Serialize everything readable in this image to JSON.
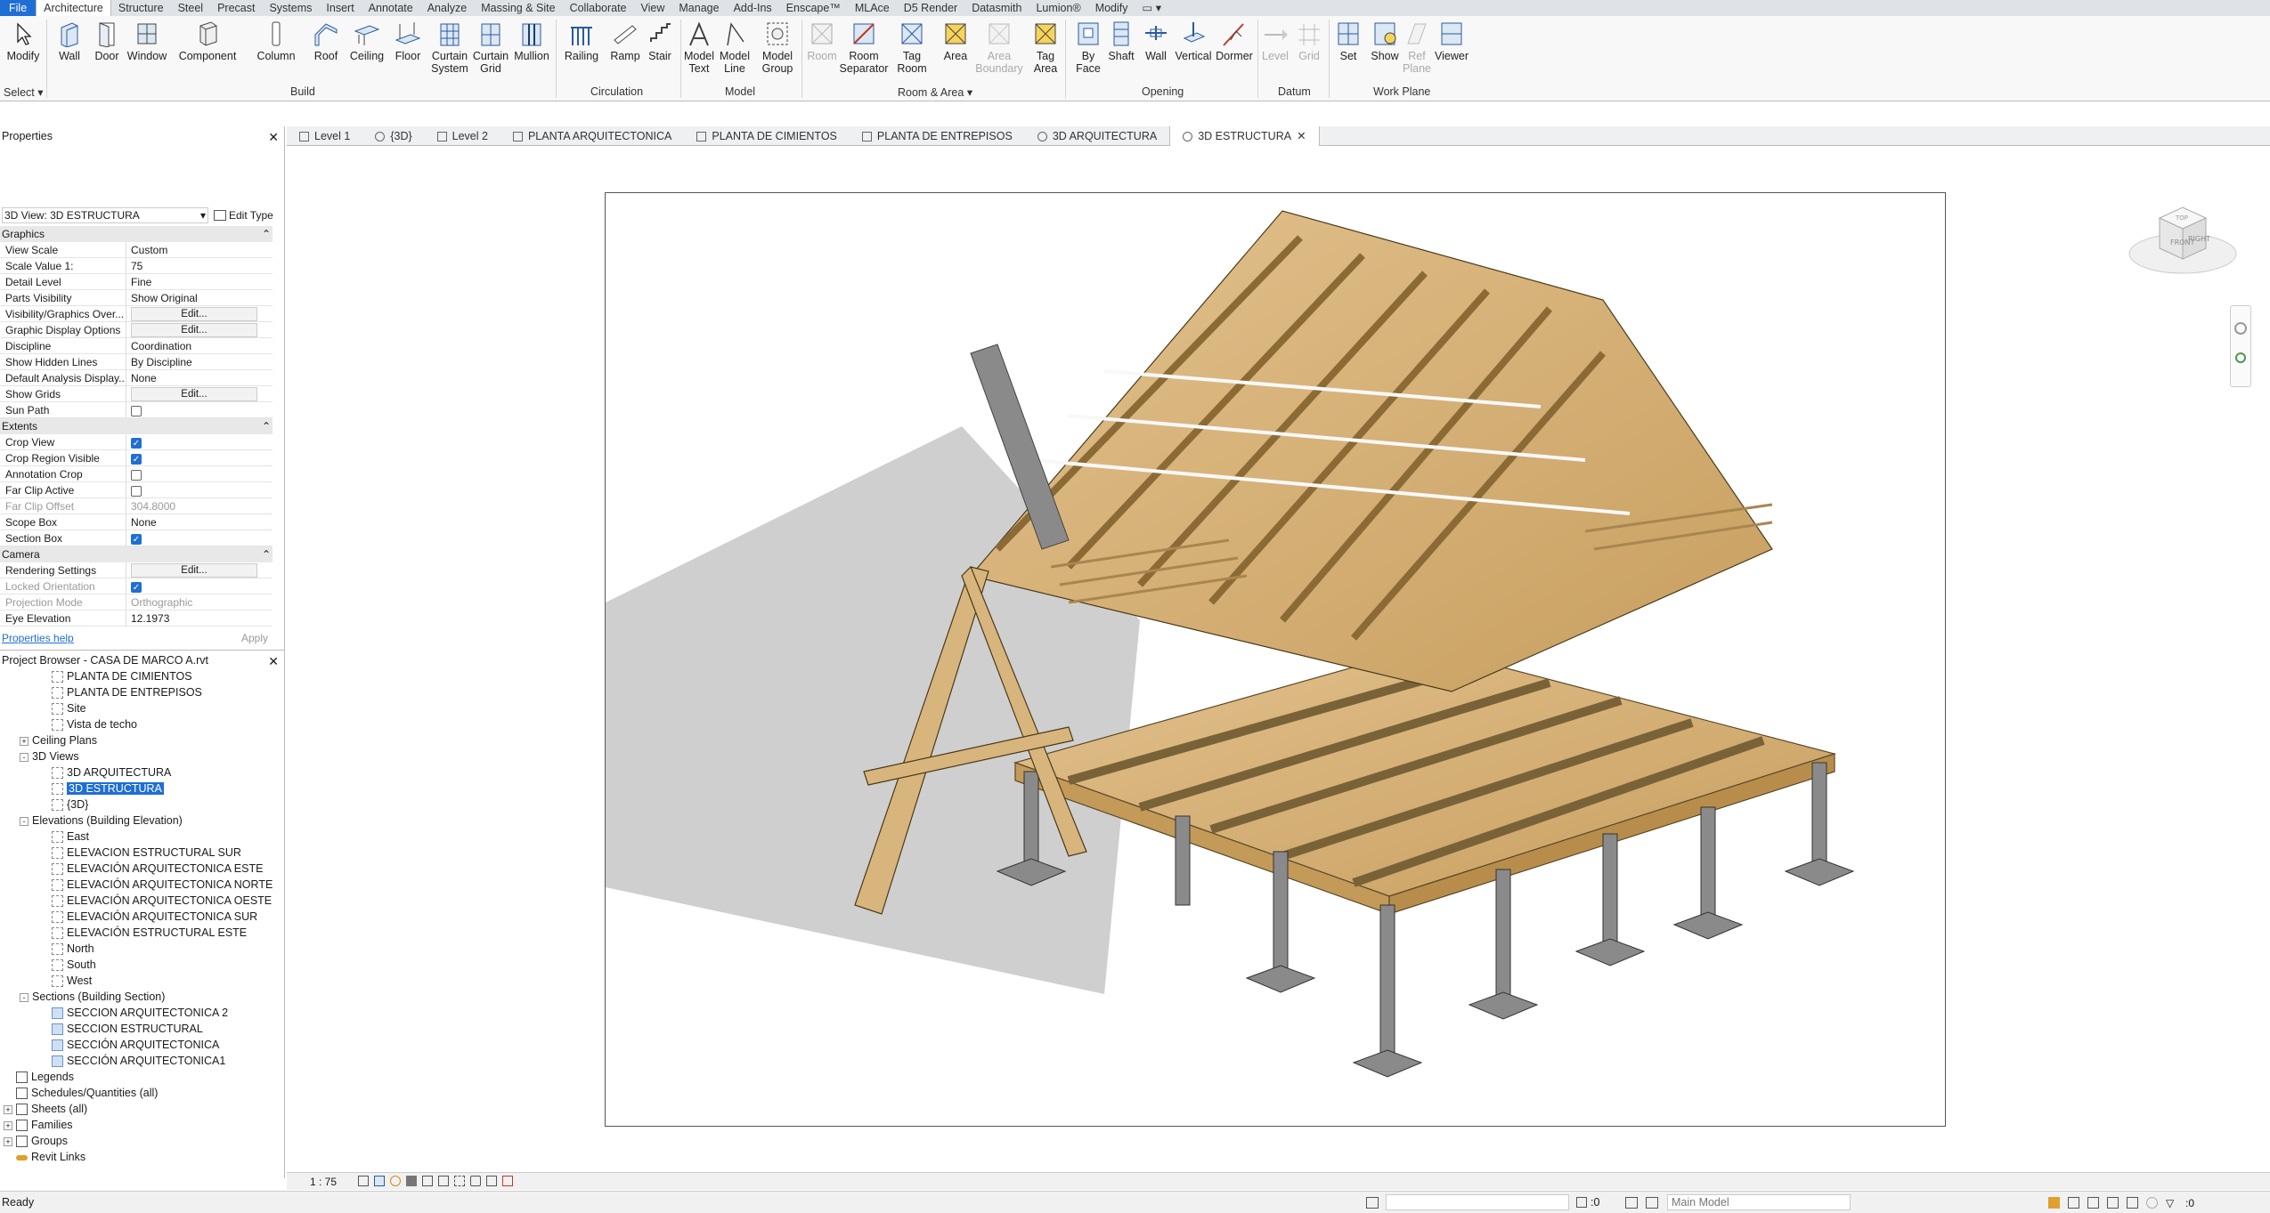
{
  "menu": {
    "tabs": [
      "File",
      "Architecture",
      "Structure",
      "Steel",
      "Precast",
      "Systems",
      "Insert",
      "Annotate",
      "Analyze",
      "Massing & Site",
      "Collaborate",
      "View",
      "Manage",
      "Add-Ins",
      "Enscape™",
      "MLAce",
      "D5 Render",
      "Datasmith",
      "Lumion®",
      "Modify"
    ],
    "active": "Architecture"
  },
  "ribbon": {
    "select": {
      "modify": "Modify",
      "select": "Select"
    },
    "build": {
      "label": "Build",
      "wall": "Wall",
      "door": "Door",
      "window": "Window",
      "component": "Component",
      "column": "Column",
      "roof": "Roof",
      "ceiling": "Ceiling",
      "floor": "Floor",
      "curtain_system": "Curtain\nSystem",
      "curtain_grid": "Curtain\nGrid",
      "mullion": "Mullion"
    },
    "circulation": {
      "label": "Circulation",
      "railing": "Railing",
      "ramp": "Ramp",
      "stair": "Stair"
    },
    "model": {
      "label": "Model",
      "model_text": "Model\nText",
      "model_line": "Model\nLine",
      "model_group": "Model\nGroup"
    },
    "room": {
      "label": "Room & Area",
      "room": "Room",
      "room_separator": "Room\nSeparator",
      "tag_room": "Tag\nRoom",
      "area": "Area",
      "area_boundary": "Area\nBoundary",
      "tag_area": "Tag\nArea"
    },
    "opening": {
      "label": "Opening",
      "by_face": "By\nFace",
      "shaft": "Shaft",
      "wall": "Wall",
      "vertical": "Vertical",
      "dormer": "Dormer"
    },
    "datum": {
      "label": "Datum",
      "level": "Level",
      "grid": "Grid"
    },
    "workplane": {
      "label": "Work Plane",
      "set": "Set",
      "show": "Show",
      "ref_plane": "Ref\nPlane",
      "viewer": "Viewer"
    }
  },
  "properties": {
    "title": "Properties",
    "type_selector": "3D View: 3D ESTRUCTURA",
    "edit_type": "Edit Type",
    "graphics_header": "Graphics",
    "graphics": [
      {
        "k": "View Scale",
        "v": "Custom"
      },
      {
        "k": "Scale Value    1:",
        "v": "75"
      },
      {
        "k": "Detail Level",
        "v": "Fine"
      },
      {
        "k": "Parts Visibility",
        "v": "Show Original"
      },
      {
        "k": "Visibility/Graphics Over...",
        "v": "Edit...",
        "btn": true
      },
      {
        "k": "Graphic Display Options",
        "v": "Edit...",
        "btn": true
      },
      {
        "k": "Discipline",
        "v": "Coordination"
      },
      {
        "k": "Show Hidden Lines",
        "v": "By Discipline"
      },
      {
        "k": "Default Analysis Display...",
        "v": "None"
      },
      {
        "k": "Show Grids",
        "v": "Edit...",
        "btn": true
      },
      {
        "k": "Sun Path",
        "v": "",
        "cb": false
      }
    ],
    "extents_header": "Extents",
    "extents": [
      {
        "k": "Crop View",
        "v": "",
        "cb": true
      },
      {
        "k": "Crop Region Visible",
        "v": "",
        "cb": true
      },
      {
        "k": "Annotation Crop",
        "v": "",
        "cb": false
      },
      {
        "k": "Far Clip Active",
        "v": "",
        "cb": false
      },
      {
        "k": "Far Clip Offset",
        "v": "304.8000",
        "dis": true
      },
      {
        "k": "Scope Box",
        "v": "None"
      },
      {
        "k": "Section Box",
        "v": "",
        "cb": true
      }
    ],
    "camera_header": "Camera",
    "camera": [
      {
        "k": "Rendering Settings",
        "v": "Edit...",
        "btn": true
      },
      {
        "k": "Locked Orientation",
        "v": "",
        "cb": true,
        "dis": true
      },
      {
        "k": "Projection Mode",
        "v": "Orthographic",
        "dis": true
      },
      {
        "k": "Eye Elevation",
        "v": "12.1973"
      }
    ],
    "help": "Properties help",
    "apply": "Apply"
  },
  "browser": {
    "title": "Project Browser - CASA DE MARCO A.rvt",
    "items": [
      {
        "t": "PLANTA DE CIMIENTOS",
        "lvl": 3,
        "ic": "view"
      },
      {
        "t": "PLANTA DE ENTREPISOS",
        "lvl": 3,
        "ic": "view"
      },
      {
        "t": "Site",
        "lvl": 3,
        "ic": "view"
      },
      {
        "t": "Vista de techo",
        "lvl": 3,
        "ic": "view"
      },
      {
        "t": "Ceiling Plans",
        "lvl": 1,
        "exp": "+"
      },
      {
        "t": "3D Views",
        "lvl": 1,
        "exp": "-"
      },
      {
        "t": "3D ARQUITECTURA",
        "lvl": 3,
        "ic": "view"
      },
      {
        "t": "3D ESTRUCTURA",
        "lvl": 3,
        "ic": "view",
        "sel": true
      },
      {
        "t": "{3D}",
        "lvl": 3,
        "ic": "view"
      },
      {
        "t": "Elevations (Building Elevation)",
        "lvl": 1,
        "exp": "-"
      },
      {
        "t": "East",
        "lvl": 3,
        "ic": "view"
      },
      {
        "t": "ELEVACION ESTRUCTURAL SUR",
        "lvl": 3,
        "ic": "view"
      },
      {
        "t": "ELEVACIÓN ARQUITECTONICA ESTE",
        "lvl": 3,
        "ic": "view"
      },
      {
        "t": "ELEVACIÓN ARQUITECTONICA NORTE",
        "lvl": 3,
        "ic": "view"
      },
      {
        "t": "ELEVACIÓN ARQUITECTONICA OESTE",
        "lvl": 3,
        "ic": "view"
      },
      {
        "t": "ELEVACIÓN ARQUITECTONICA SUR",
        "lvl": 3,
        "ic": "view"
      },
      {
        "t": "ELEVACIÓN ESTRUCTURAL ESTE",
        "lvl": 3,
        "ic": "view"
      },
      {
        "t": "North",
        "lvl": 3,
        "ic": "view"
      },
      {
        "t": "South",
        "lvl": 3,
        "ic": "view"
      },
      {
        "t": "West",
        "lvl": 3,
        "ic": "view"
      },
      {
        "t": "Sections (Building Section)",
        "lvl": 1,
        "exp": "-"
      },
      {
        "t": "SECCION ARQUITECTONICA 2",
        "lvl": 3,
        "ic": "sec"
      },
      {
        "t": "SECCION ESTRUCTURAL",
        "lvl": 3,
        "ic": "sec"
      },
      {
        "t": "SECCIÓN ARQUITECTONICA",
        "lvl": 3,
        "ic": "sec"
      },
      {
        "t": "SECCIÓN ARQUITECTONICA1",
        "lvl": 3,
        "ic": "sec"
      },
      {
        "t": "Legends",
        "lvl": 0,
        "ic": "grid"
      },
      {
        "t": "Schedules/Quantities (all)",
        "lvl": 0,
        "ic": "grid"
      },
      {
        "t": "Sheets (all)",
        "lvl": 0,
        "exp": "+",
        "ic": "grid"
      },
      {
        "t": "Families",
        "lvl": 0,
        "exp": "+",
        "ic": "grid"
      },
      {
        "t": "Groups",
        "lvl": 0,
        "exp": "+",
        "ic": "grid"
      },
      {
        "t": "Revit Links",
        "lvl": 0,
        "ic": "link"
      }
    ]
  },
  "doc_tabs": [
    {
      "label": "Level 1",
      "icon": "plan"
    },
    {
      "label": "{3D}",
      "icon": "3d"
    },
    {
      "label": "Level 2",
      "icon": "plan"
    },
    {
      "label": "PLANTA ARQUITECTONICA",
      "icon": "plan"
    },
    {
      "label": "PLANTA DE CIMIENTOS",
      "icon": "plan"
    },
    {
      "label": "PLANTA DE ENTREPISOS",
      "icon": "plan"
    },
    {
      "label": "3D ARQUITECTURA",
      "icon": "3d"
    },
    {
      "label": "3D ESTRUCTURA",
      "icon": "3d",
      "active": true
    }
  ],
  "viewcube": {
    "front": "FRONT",
    "right": "RIGHT",
    "top": "TOP"
  },
  "view_bar": {
    "scale": "1 : 75"
  },
  "status": {
    "text": "Ready",
    "zero": ":0",
    "model": "Main Model"
  }
}
